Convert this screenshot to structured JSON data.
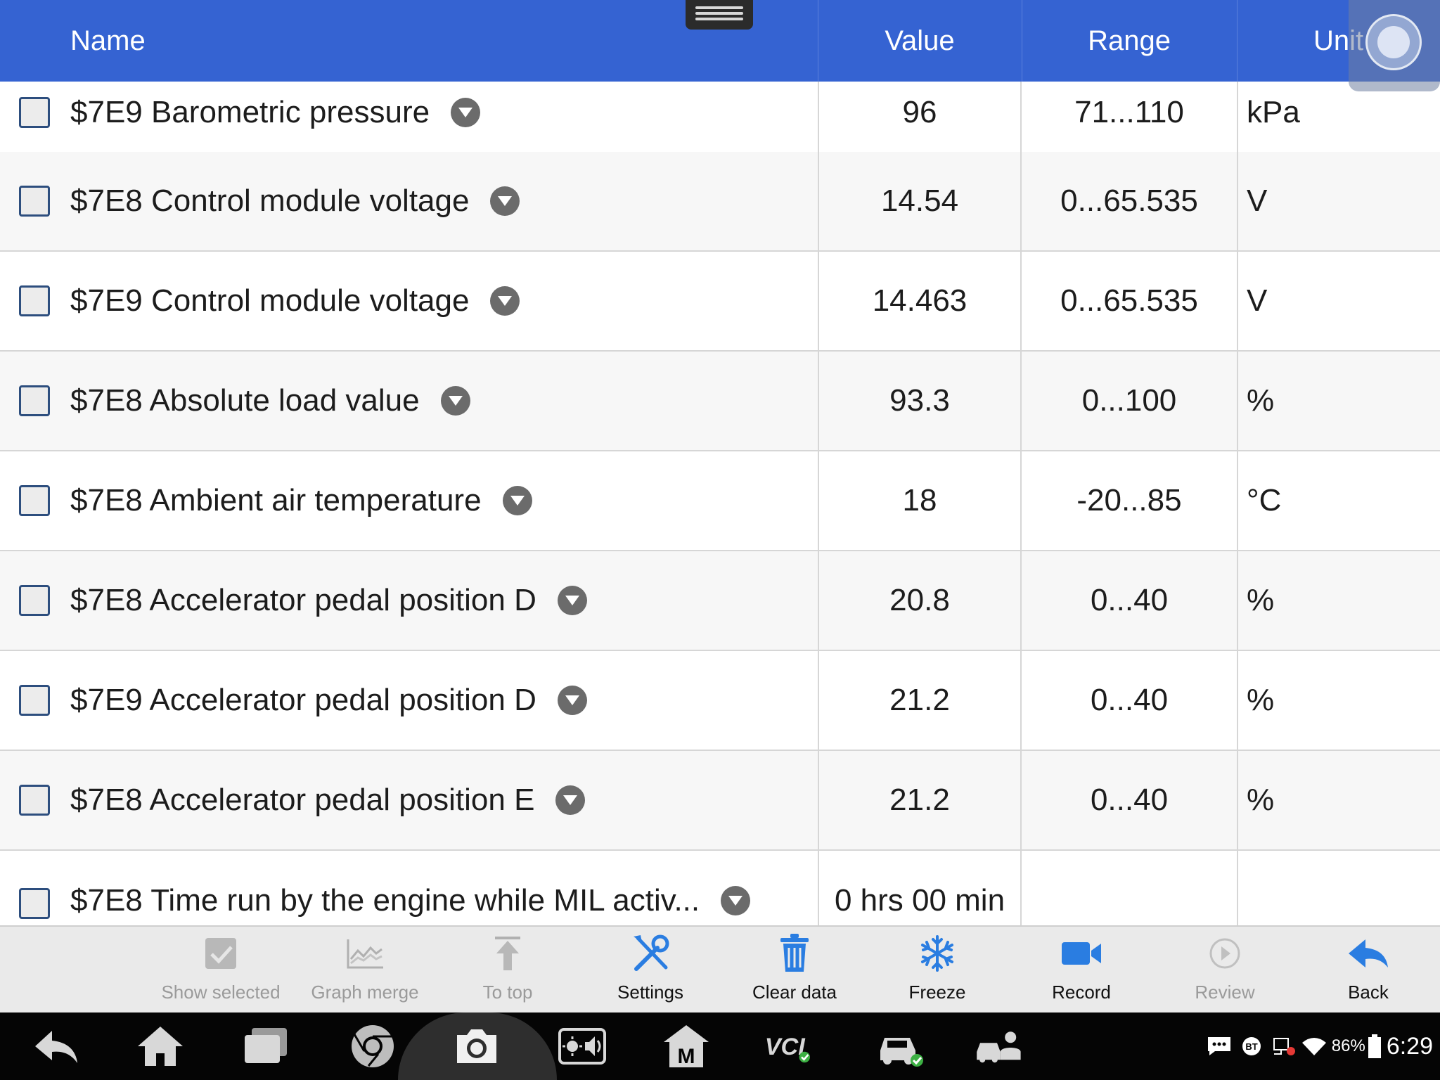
{
  "header": {
    "name_label": "Name",
    "value_label": "Value",
    "range_label": "Range",
    "unit_label": "Unit"
  },
  "rows": [
    {
      "name": "$7E9 Barometric pressure",
      "value": "96",
      "range": "71...110",
      "unit": "kPa"
    },
    {
      "name": "$7E8 Control module voltage",
      "value": "14.54",
      "range": "0...65.535",
      "unit": "V"
    },
    {
      "name": "$7E9 Control module voltage",
      "value": "14.463",
      "range": "0...65.535",
      "unit": "V"
    },
    {
      "name": "$7E8 Absolute load value",
      "value": "93.3",
      "range": "0...100",
      "unit": "%"
    },
    {
      "name": "$7E8 Ambient air temperature",
      "value": "18",
      "range": "-20...85",
      "unit": "°C"
    },
    {
      "name": "$7E8 Accelerator pedal position D",
      "value": "20.8",
      "range": "0...40",
      "unit": "%"
    },
    {
      "name": "$7E9 Accelerator pedal position D",
      "value": "21.2",
      "range": "0...40",
      "unit": "%"
    },
    {
      "name": "$7E8 Accelerator pedal position E",
      "value": "21.2",
      "range": "0...40",
      "unit": "%"
    },
    {
      "name": "$7E8 Time run by the engine while MIL activ...",
      "value": "0 hrs 00 min",
      "range": "",
      "unit": ""
    }
  ],
  "toolbar": {
    "show_selected": "Show selected",
    "graph_merge": "Graph merge",
    "to_top": "To top",
    "settings": "Settings",
    "clear_data": "Clear data",
    "freeze": "Freeze",
    "record": "Record",
    "review": "Review",
    "back": "Back"
  },
  "status_bar": {
    "battery": "86%",
    "time": "6:29",
    "bt_label": "BT"
  },
  "colors": {
    "header_bg": "#3563d2",
    "accent_icon": "#2a7de1",
    "disabled": "#9a9a9a"
  }
}
